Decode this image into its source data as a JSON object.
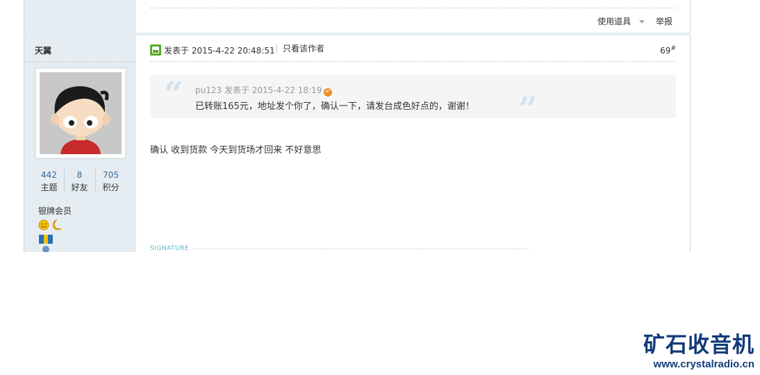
{
  "toolbar": {
    "use_tools": "使用道具",
    "report": "举报"
  },
  "author": {
    "name": "天翼",
    "stats": [
      {
        "value": "442",
        "label": "主题"
      },
      {
        "value": "8",
        "label": "好友"
      },
      {
        "value": "705",
        "label": "积分"
      }
    ],
    "rank": "银牌会员"
  },
  "post": {
    "posted_at": "发表于 2015-4-22 20:48:51",
    "only_author": "只看该作者",
    "floor": "69",
    "floor_suffix": "#",
    "quote": {
      "header": "pu123 发表于 2015-4-22 18:19",
      "body": "已转账165元，地址发个你了，确认一下，请发台成色好点的，谢谢！"
    },
    "reply": "确认 收到货款  今天到货场才回来 不好意思",
    "signature_label": "SIGNATURE"
  },
  "watermark": {
    "title": "矿石收音机",
    "url": "www.crystalradio.cn"
  },
  "colors": {
    "link": "#336699",
    "sidebar_bg": "#e5edf2",
    "border": "#c2d5e3",
    "watermark": "#113a78"
  }
}
